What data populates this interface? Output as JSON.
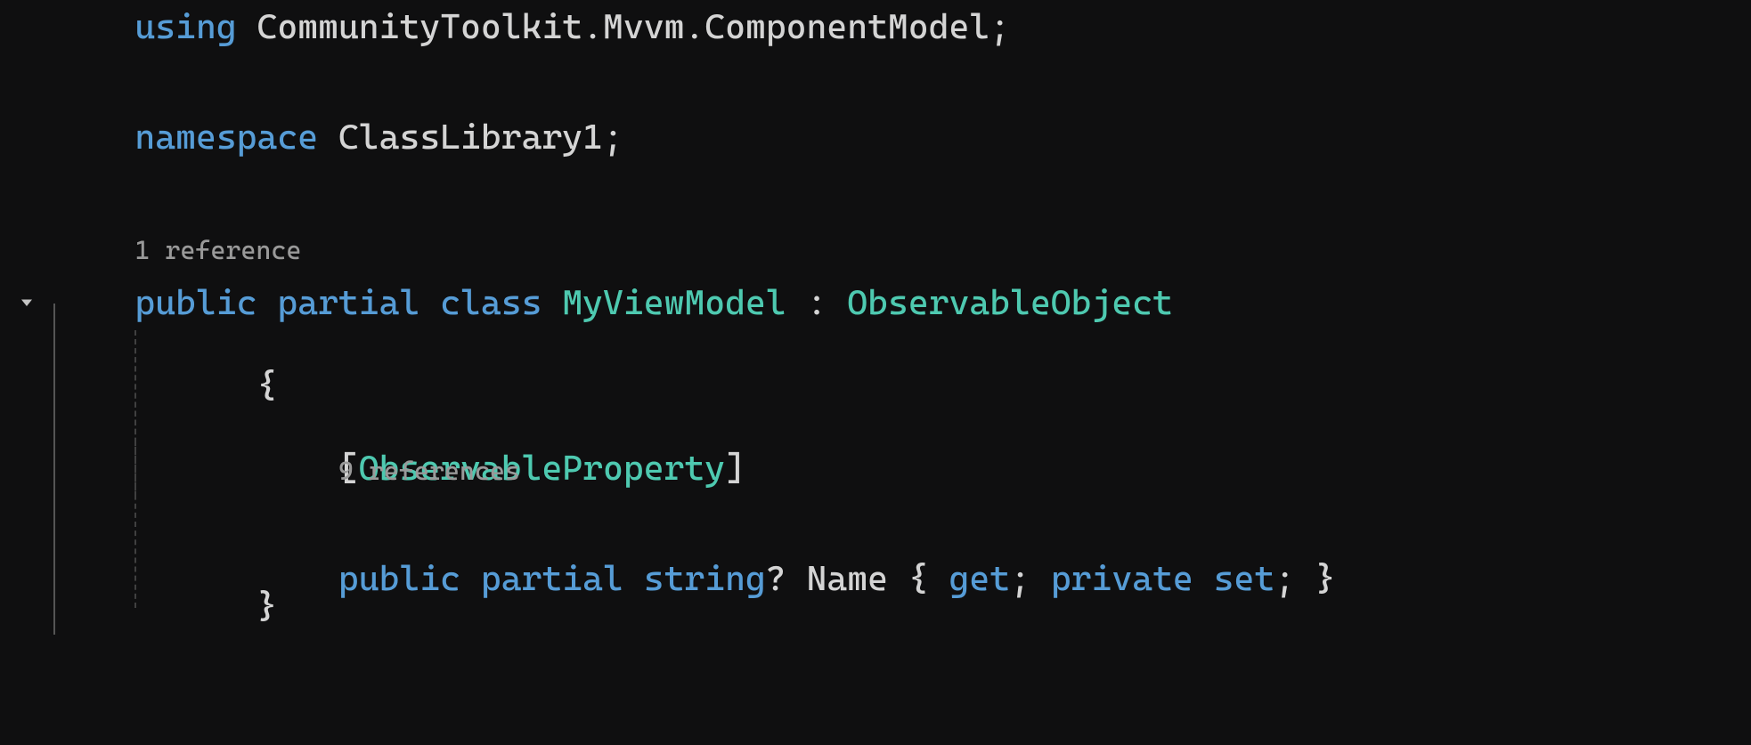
{
  "code": {
    "l1": {
      "using": "using",
      "ns": "CommunityToolkit.Mvvm.ComponentModel",
      "semi": ";"
    },
    "l3": {
      "namespace": "namespace",
      "name": "ClassLibrary1",
      "semi": ";"
    },
    "codelens1": "1 reference",
    "l5": {
      "public": "public",
      "partial": "partial",
      "class": "class",
      "name": "MyViewModel",
      "colon": ":",
      "base": "ObservableObject"
    },
    "l6": {
      "brace": "{"
    },
    "l7": {
      "lbracket": "[",
      "attr": "ObservableProperty",
      "rbracket": "]"
    },
    "codelens2": "9 references",
    "l8": {
      "public": "public",
      "partial": "partial",
      "type": "string",
      "nullable": "?",
      "name": "Name",
      "lbrace": "{",
      "get": "get",
      "semi1": ";",
      "private": "private",
      "set": "set",
      "semi2": ";",
      "rbrace": "}"
    },
    "l9": {
      "brace": "}"
    }
  }
}
